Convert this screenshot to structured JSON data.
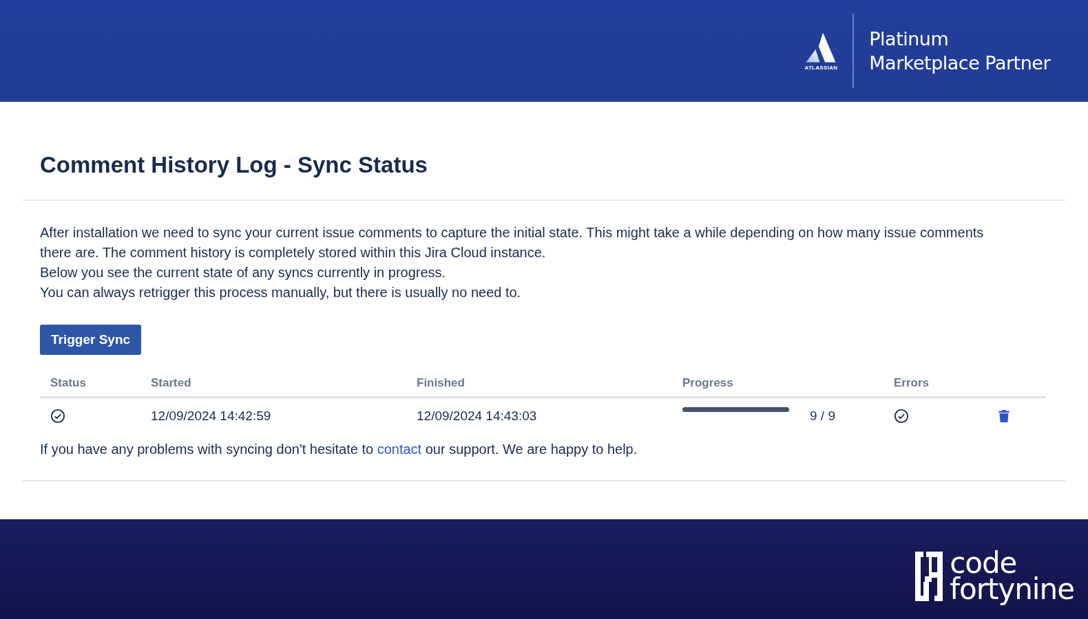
{
  "header": {
    "vendor_wordmark": "ATLASSIAN",
    "partner_lines": [
      "Platinum",
      "Marketplace Partner"
    ]
  },
  "title": "Comment History Log - Sync Status",
  "intro": [
    "After installation we need to sync your current issue comments to capture the initial state. This might take a while depending on how many issue comments there are. The comment history is completely stored within this Jira Cloud instance.",
    "Below you see the current state of any syncs currently in progress.",
    "You can always retrigger this process manually, but there is usually no need to."
  ],
  "trigger_button": "Trigger Sync",
  "table": {
    "columns": [
      "Status",
      "Started",
      "Finished",
      "Progress",
      "Errors"
    ],
    "rows": [
      {
        "status_ok": true,
        "started": "12/09/2024 14:42:59",
        "finished": "12/09/2024 14:43:03",
        "level": 1,
        "count": "9 / 9",
        "errors_ok": true
      }
    ]
  },
  "support": {
    "before": "If you have any problems with syncing don't hesitate to",
    "link": "contact",
    "after": "our support. We are happy to help."
  },
  "footer": {
    "logo_lines": [
      "code",
      "fortynine"
    ]
  }
}
